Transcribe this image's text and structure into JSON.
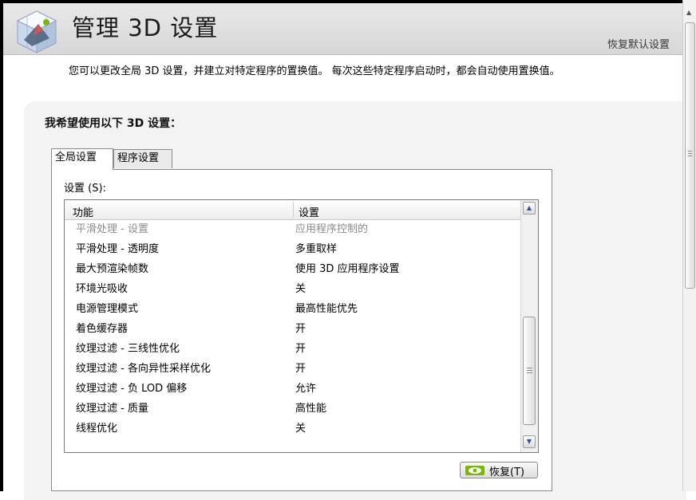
{
  "header": {
    "title": "管理 3D 设置",
    "restore_defaults": "恢复默认设置"
  },
  "intro": "您可以更改全局 3D 设置，并建立对特定程序的置换值。 每次这些特定程序启动时，都会自动使用置换值。",
  "section_title": "我希望使用以下 3D 设置：",
  "tabs": [
    {
      "label": "全局设置",
      "active": true
    },
    {
      "label": "程序设置",
      "active": false
    }
  ],
  "settings_label": "设置 (S):",
  "table": {
    "columns": [
      "功能",
      "设置"
    ],
    "rows": [
      {
        "feature": "平滑处理 - 设置",
        "value": "应用程序控制的"
      },
      {
        "feature": "平滑处理 - 透明度",
        "value": "多重取样"
      },
      {
        "feature": "最大预渲染帧数",
        "value": "使用 3D 应用程序设置"
      },
      {
        "feature": "环境光吸收",
        "value": "关"
      },
      {
        "feature": "电源管理模式",
        "value": "最高性能优先"
      },
      {
        "feature": "着色缓存器",
        "value": "开"
      },
      {
        "feature": "纹理过滤 - 三线性优化",
        "value": "开"
      },
      {
        "feature": "纹理过滤 - 各向异性采样优化",
        "value": "开"
      },
      {
        "feature": "纹理过滤 - 负 LOD 偏移",
        "value": "允许"
      },
      {
        "feature": "纹理过滤 - 质量",
        "value": "高性能"
      },
      {
        "feature": "线程优化",
        "value": "关"
      }
    ]
  },
  "restore_button": "恢复(T)",
  "colors": {
    "header_bg": "#dedede",
    "panel_bg": "#f3f3f3",
    "disabled_text": "#8c8c8c",
    "nvidia_green": "#76b900"
  }
}
